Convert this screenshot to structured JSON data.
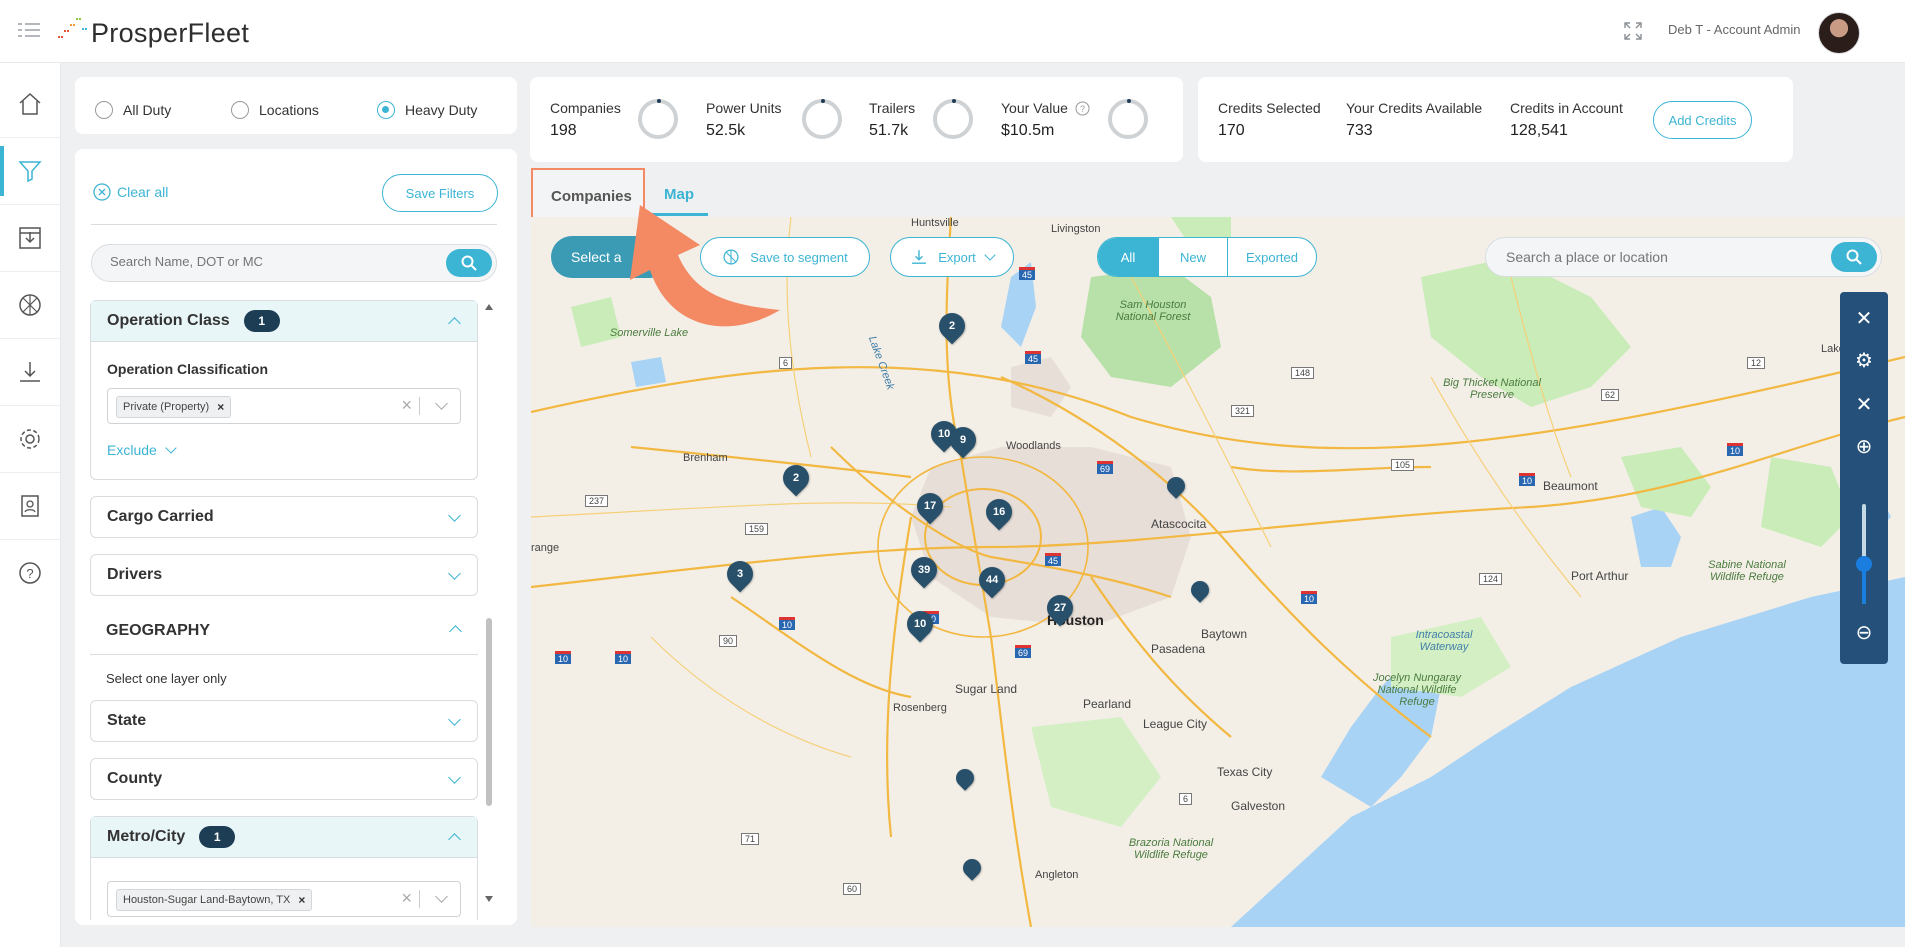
{
  "header": {
    "logo_text": "ProsperFleet",
    "user_label": "Deb T - Account Admin"
  },
  "sidenav": {
    "items": [
      "home-icon",
      "filter-icon",
      "import-icon",
      "segment-icon",
      "download-icon",
      "settings-icon",
      "contacts-icon",
      "help-icon"
    ]
  },
  "duty_filter": {
    "options": [
      "All Duty",
      "Locations",
      "Heavy Duty"
    ],
    "selected": "Heavy Duty"
  },
  "stats": {
    "companies_label": "Companies",
    "companies_value": "198",
    "power_units_label": "Power Units",
    "power_units_value": "52.5k",
    "trailers_label": "Trailers",
    "trailers_value": "51.7k",
    "your_value_label": "Your Value",
    "your_value_value": "$10.5m"
  },
  "credits": {
    "selected_label": "Credits Selected",
    "selected_value": "170",
    "available_label": "Your Credits Available",
    "available_value": "733",
    "account_label": "Credits in Account",
    "account_value": "128,541",
    "add_button": "Add Credits"
  },
  "filters": {
    "clear_all": "Clear all",
    "save_filters": "Save Filters",
    "search_placeholder": "Search Name, DOT or MC",
    "operation_class": {
      "title": "Operation Class",
      "count": "1",
      "sub_label": "Operation Classification",
      "chip": "Private (Property)",
      "exclude": "Exclude"
    },
    "cargo_carried": "Cargo Carried",
    "drivers": "Drivers",
    "geography": {
      "title": "GEOGRAPHY",
      "hint": "Select one layer only"
    },
    "state": "State",
    "county": "County",
    "metro_city": {
      "title": "Metro/City",
      "count": "1",
      "chip": "Houston-Sugar Land-Baytown, TX"
    }
  },
  "tabs": {
    "companies": "Companies",
    "map": "Map",
    "active": "Map"
  },
  "map_toolbar": {
    "select_label": "Select a",
    "save_segment": "Save to segment",
    "export": "Export",
    "segments": [
      "All",
      "New",
      "Exported"
    ],
    "active_segment": "All",
    "place_search_placeholder": "Search a place or location"
  },
  "map": {
    "cities": [
      "Huntsville",
      "Livingston",
      "Sam Houston National Forest",
      "Somerville Lake",
      "Lake Creek",
      "Brenham",
      "Woodlands",
      "Big Thicket National Preserve",
      "Beaumont",
      "Atascocita",
      "Port Arthur",
      "Sabine National Wildlife Refuge",
      "Houston",
      "Baytown",
      "Pasadena",
      "Sugar Land",
      "Rosenberg",
      "Pearland",
      "League City",
      "Intracoastal Waterway",
      "Jocelyn Nungaray National Wildlife Refuge",
      "Texas City",
      "Galveston",
      "Brazoria National Wildlife Refuge",
      "Angleton",
      "Lake Charles",
      "range"
    ],
    "pins": [
      {
        "label": "2"
      },
      {
        "label": "10"
      },
      {
        "label": "9"
      },
      {
        "label": "2"
      },
      {
        "label": "17"
      },
      {
        "label": "16"
      },
      {
        "label": "3"
      },
      {
        "label": "39"
      },
      {
        "label": "44"
      },
      {
        "label": "27"
      },
      {
        "label": "10"
      },
      {
        "label": ""
      },
      {
        "label": ""
      },
      {
        "label": ""
      },
      {
        "label": ""
      }
    ],
    "highway_shields": [
      "45",
      "45",
      "69",
      "45",
      "10",
      "10",
      "10",
      "10",
      "10",
      "69",
      "10",
      "10",
      "6",
      "105",
      "148",
      "321",
      "237",
      "159",
      "90",
      "71",
      "60",
      "6",
      "12",
      "62",
      "124"
    ]
  },
  "colors": {
    "accent": "#3cb4d3",
    "navy": "#1c3d54",
    "annotation": "#f38a63"
  }
}
